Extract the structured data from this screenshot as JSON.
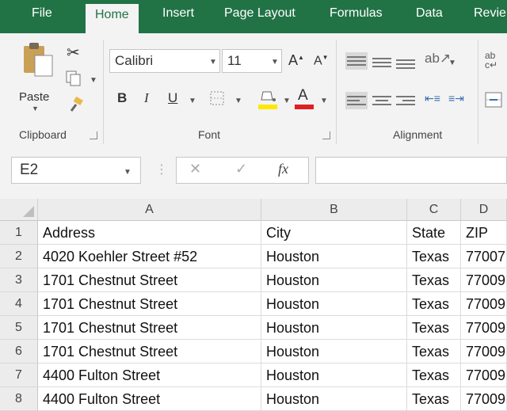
{
  "tabs": [
    "File",
    "Home",
    "Insert",
    "Page Layout",
    "Formulas",
    "Data",
    "Revie"
  ],
  "ribbon": {
    "paste_label": "Paste",
    "font_name": "Calibri",
    "font_size": "11",
    "bold": "B",
    "italic": "I",
    "underline": "U",
    "groups": {
      "clipboard": "Clipboard",
      "font": "Font",
      "alignment": "Alignment"
    }
  },
  "formula_bar": {
    "name_box": "E2",
    "cancel": "✕",
    "enter": "✓",
    "fx": "fx",
    "formula": ""
  },
  "sheet": {
    "columns": [
      "A",
      "B",
      "C",
      "D"
    ],
    "row_numbers": [
      "1",
      "2",
      "3",
      "4",
      "5",
      "6",
      "7",
      "8"
    ],
    "rows": [
      [
        "Address",
        "City",
        "State",
        "ZIP"
      ],
      [
        "4020 Koehler Street #52",
        "Houston",
        "Texas",
        "77007"
      ],
      [
        "1701 Chestnut Street",
        "Houston",
        "Texas",
        "77009"
      ],
      [
        "1701 Chestnut Street",
        "Houston",
        "Texas",
        "77009"
      ],
      [
        "1701 Chestnut Street",
        "Houston",
        "Texas",
        "77009"
      ],
      [
        "1701 Chestnut Street",
        "Houston",
        "Texas",
        "77009"
      ],
      [
        "4400 Fulton Street",
        "Houston",
        "Texas",
        "77009"
      ],
      [
        "4400 Fulton Street",
        "Houston",
        "Texas",
        "77009"
      ]
    ]
  },
  "colors": {
    "accent": "#217346",
    "font_color": "#e02020",
    "highlight": "#ffe800"
  },
  "icons": [
    "paste-icon",
    "cut-icon",
    "copy-icon",
    "format-painter-icon",
    "increase-font-icon",
    "decrease-font-icon",
    "borders-icon",
    "fill-color-icon",
    "font-color-icon",
    "orientation-icon",
    "wrap-text-icon",
    "merge-icon"
  ]
}
